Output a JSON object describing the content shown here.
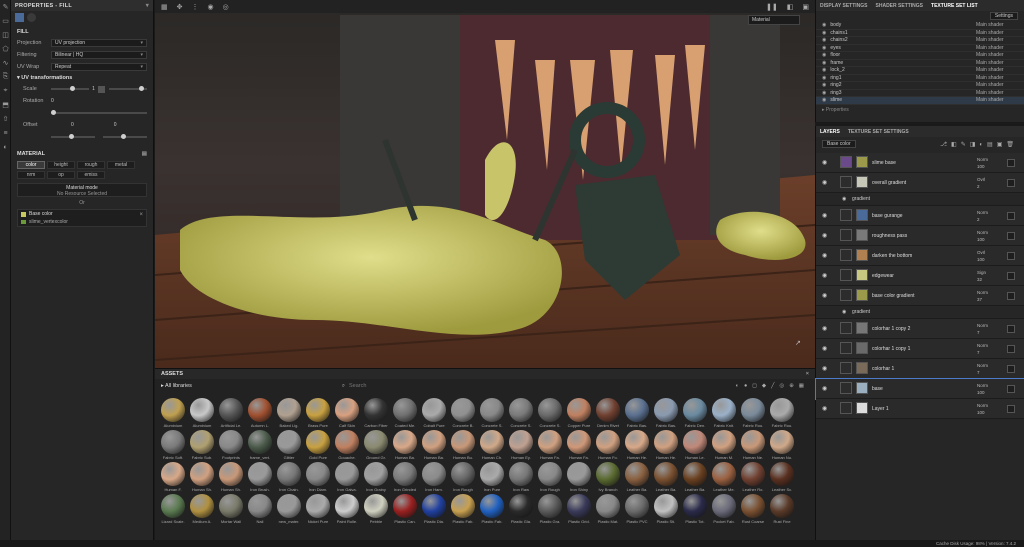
{
  "properties": {
    "title": "PROPERTIES - FILL",
    "fill_section": "FILL",
    "projection_label": "Projection",
    "projection_value": "UV projection",
    "filtering_label": "Filtering",
    "filtering_value": "Bilinear | HQ",
    "uvwrap_label": "UV Wrap",
    "uvwrap_value": "Repeat",
    "uvt_label": "UV transformations",
    "scale_label": "Scale",
    "scale_value": "1",
    "rotation_label": "Rotation",
    "rotation_value": "0",
    "offset_label": "Offset",
    "offset_x": "0",
    "offset_y": "0",
    "material_section": "MATERIAL",
    "channels": [
      "color",
      "height",
      "rough",
      "metal",
      "nrm",
      "op",
      "emiss"
    ],
    "material_mode_label": "Material mode",
    "material_mode_value": "No Resource Selected",
    "or_label": "Or",
    "base_color_label": "Base color",
    "base_color_resource": "slime_vertexcolor"
  },
  "viewport": {
    "material_dropdown": "Material"
  },
  "texture_sets": {
    "tabs": [
      "DISPLAY SETTINGS",
      "SHADER SETTINGS",
      "TEXTURE SET LIST"
    ],
    "settings_btn": "Settings",
    "items": [
      {
        "name": "body",
        "shader": "Main shader"
      },
      {
        "name": "chains1",
        "shader": "Main shader"
      },
      {
        "name": "chains2",
        "shader": "Main shader"
      },
      {
        "name": "eyes",
        "shader": "Main shader"
      },
      {
        "name": "floor",
        "shader": "Main shader"
      },
      {
        "name": "frame",
        "shader": "Main shader"
      },
      {
        "name": "lock_2",
        "shader": "Main shader"
      },
      {
        "name": "ring1",
        "shader": "Main shader"
      },
      {
        "name": "ring2",
        "shader": "Main shader"
      },
      {
        "name": "ring3",
        "shader": "Main shader"
      },
      {
        "name": "slime",
        "shader": "Main shader"
      }
    ],
    "properties_label": "Properties"
  },
  "layers": {
    "tabs": [
      "LAYERS",
      "TEXTURE SET SETTINGS"
    ],
    "channel_dropdown": "Base color",
    "rows": [
      {
        "name": "slime base",
        "mode": "Norm",
        "val": "100",
        "type": "folder"
      },
      {
        "name": "overall gradient",
        "mode": "Ovrl",
        "val": "2",
        "type": "layer"
      },
      {
        "name": "gradient",
        "mode": "",
        "val": "",
        "type": "sub"
      },
      {
        "name": "base gurange",
        "mode": "Norm",
        "val": "2",
        "type": "layer"
      },
      {
        "name": "roughness pass",
        "mode": "Norm",
        "val": "100",
        "type": "layer"
      },
      {
        "name": "darken the bottom",
        "mode": "Ovrl",
        "val": "100",
        "type": "layer"
      },
      {
        "name": "edgewear",
        "mode": "Sign",
        "val": "32",
        "type": "layer"
      },
      {
        "name": "base color gradient",
        "mode": "Norm",
        "val": "37",
        "type": "layer"
      },
      {
        "name": "gradient",
        "mode": "",
        "val": "",
        "type": "sub"
      },
      {
        "name": "colorhar 1 copy 2",
        "mode": "Norm",
        "val": "7",
        "type": "layer"
      },
      {
        "name": "colorhar 1 copy 1",
        "mode": "Norm",
        "val": "7",
        "type": "layer"
      },
      {
        "name": "colorhar 1",
        "mode": "Norm",
        "val": "7",
        "type": "layer"
      },
      {
        "name": "base",
        "mode": "Norm",
        "val": "100",
        "type": "layer"
      },
      {
        "name": "Layer 1",
        "mode": "Norm",
        "val": "100",
        "type": "layer"
      }
    ]
  },
  "assets": {
    "title": "ASSETS",
    "library": "All libraries",
    "search_placeholder": "Search",
    "items": [
      "Aluminium",
      "Aluminium",
      "Artificial Le.",
      "Autumn L.",
      "Baked Lig.",
      "Brass Pure",
      "Calf Skin",
      "Carbon Fiber",
      "Coated Me.",
      "Cobalt Pure",
      "Concrete B.",
      "Concrete S.",
      "Concrete S.",
      "Concrete S.",
      "Copper Pure",
      "Denim Rivet",
      "Fabric Bas.",
      "Fabric Bas.",
      "Fabric Den.",
      "Fabric Knit.",
      "Fabric Rou.",
      "Fabric Rou.",
      "Fabric Soft.",
      "Fabric Sub.",
      "Footprints",
      "frame_vert.",
      "Glitter",
      "Gold Pure",
      "Gouache.",
      "Ground Gr.",
      "Human Ba.",
      "Human Ba.",
      "Human Bu.",
      "Human Ch.",
      "Human Ey.",
      "Human Fa.",
      "Human Fa.",
      "Human Fo.",
      "Human He.",
      "Human He.",
      "Human Le.",
      "Human M.",
      "Human Ne.",
      "Human No.",
      "Human F.",
      "Human Sh.",
      "Human Sh.",
      "Iron Brush.",
      "Iron Chain.",
      "Iron Diam.",
      "Iron Galva.",
      "Iron Grainy",
      "Iron Grinded",
      "Iron Ham.",
      "Iron Rough",
      "Iron Pure",
      "Iron Raw",
      "Iron Rough",
      "Iron Shiny",
      "Ivy Branch",
      "Leather Ba.",
      "Leather Ba.",
      "Leather Ba.",
      "Leather Me.",
      "Leather Ro.",
      "Leather Sc.",
      "Lizard Scale.",
      "Medium A.",
      "Mortar Wall",
      "Nail",
      "new_mater.",
      "Nickel Pure",
      "Paint Rolle.",
      "Pebble",
      "Plastic Can.",
      "Plastic Dia.",
      "Plastic Fab.",
      "Plastic Fab.",
      "Plastic Gla.",
      "Plastic Gra.",
      "Plastic Grid.",
      "Plastic Mat.",
      "Plastic PVC",
      "Plastic Sti.",
      "Plastic Tot.",
      "Pocket Fab.",
      "Rust Coarse",
      "Rust Fine"
    ]
  },
  "status": {
    "text": "Cache Disk Usage: 98% | Version: 7.4.2"
  }
}
